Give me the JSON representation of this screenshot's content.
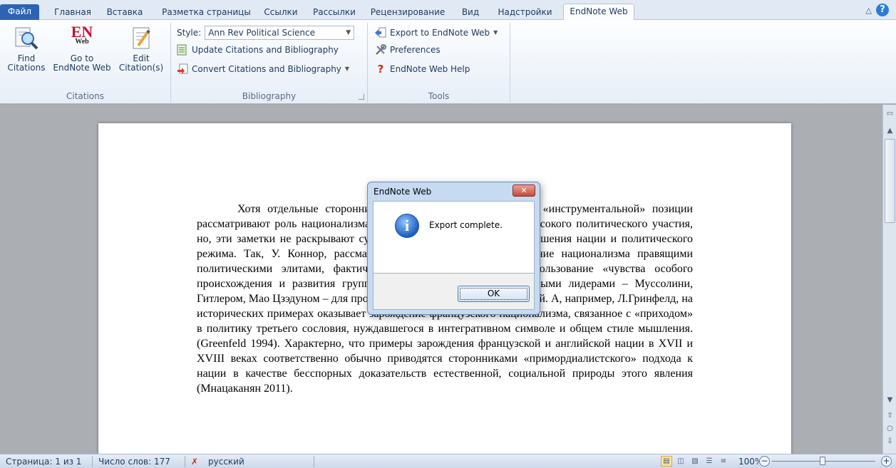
{
  "tabs": [
    {
      "label": "Файл",
      "name": "tab-file"
    },
    {
      "label": "Главная",
      "name": "tab-home"
    },
    {
      "label": "Вставка",
      "name": "tab-insert"
    },
    {
      "label": "Разметка страницы",
      "name": "tab-page-layout"
    },
    {
      "label": "Ссылки",
      "name": "tab-references"
    },
    {
      "label": "Рассылки",
      "name": "tab-mailings"
    },
    {
      "label": "Рецензирование",
      "name": "tab-review"
    },
    {
      "label": "Вид",
      "name": "tab-view"
    },
    {
      "label": "Надстройки",
      "name": "tab-addins"
    },
    {
      "label": "EndNote Web",
      "name": "tab-endnote-web"
    }
  ],
  "ribbon": {
    "citations": {
      "find_label": "Find Citations",
      "goto_label": "Go to EndNote Web",
      "goto_logo_top": "EN",
      "goto_logo_bottom": "Web",
      "edit_label": "Edit Citation(s)",
      "group_label": "Citations"
    },
    "bibliography": {
      "style_label": "Style:",
      "style_value": "Ann Rev Political Science",
      "update_label": "Update Citations and Bibliography",
      "convert_label": "Convert Citations and Bibliography",
      "group_label": "Bibliography"
    },
    "tools": {
      "export_label": "Export to EndNote Web",
      "preferences_label": "Preferences",
      "help_label": "EndNote Web Help",
      "group_label": "Tools"
    }
  },
  "document": {
    "text": "Хотя отдельные сторонники «примордиалистской», так и «инструментальной» позиции рассматривают роль национализма как инструмента обеспечения высокого политического участия, но, эти заметки не раскрывают сущностное содержание взаимоотношения нации и политического режима. Так, У. Коннор, рассматривая традиционное использование национализма правящими политическими элитами, фактически отмечает в основном использование «чувства особого происхождения и развития группы» авторитарными и тоталитарными лидерами – Муссолини, Гитлером, Мао Цзэдуном – для проведения политических мобилизаций. А, например, Л.Гринфелд, на исторических примерах оказывает зарождение французского национализма, связанное с «приходом» в политику третьего сословия, нуждавшегося в интегративном символе и общем стиле мышления. (Greenfeld 1994). Характерно, что примеры зарождения французской и английской нации в XVII и XVIII веках соответственно обычно приводятся сторонниками «примордиалистского» подхода к нации в качестве бесспорных доказательств естественной, социальной природы этого явления (Мнацаканян 2011)."
  },
  "dialog": {
    "title": "EndNote Web",
    "close_glyph": "✕",
    "message": "Export complete.",
    "ok_label": "OK"
  },
  "status": {
    "page": "Страница: 1 из 1",
    "words": "Число слов: 177",
    "language": "русский",
    "zoom": "100%",
    "zoom_level_percent": 100
  },
  "colors": {
    "file_tab": "#2d63b3",
    "ribbon_bg": "#e7eef8",
    "document_bg": "#abaeb3",
    "dialog_frame": "#c6daf1",
    "close_button": "#c74a3a"
  }
}
